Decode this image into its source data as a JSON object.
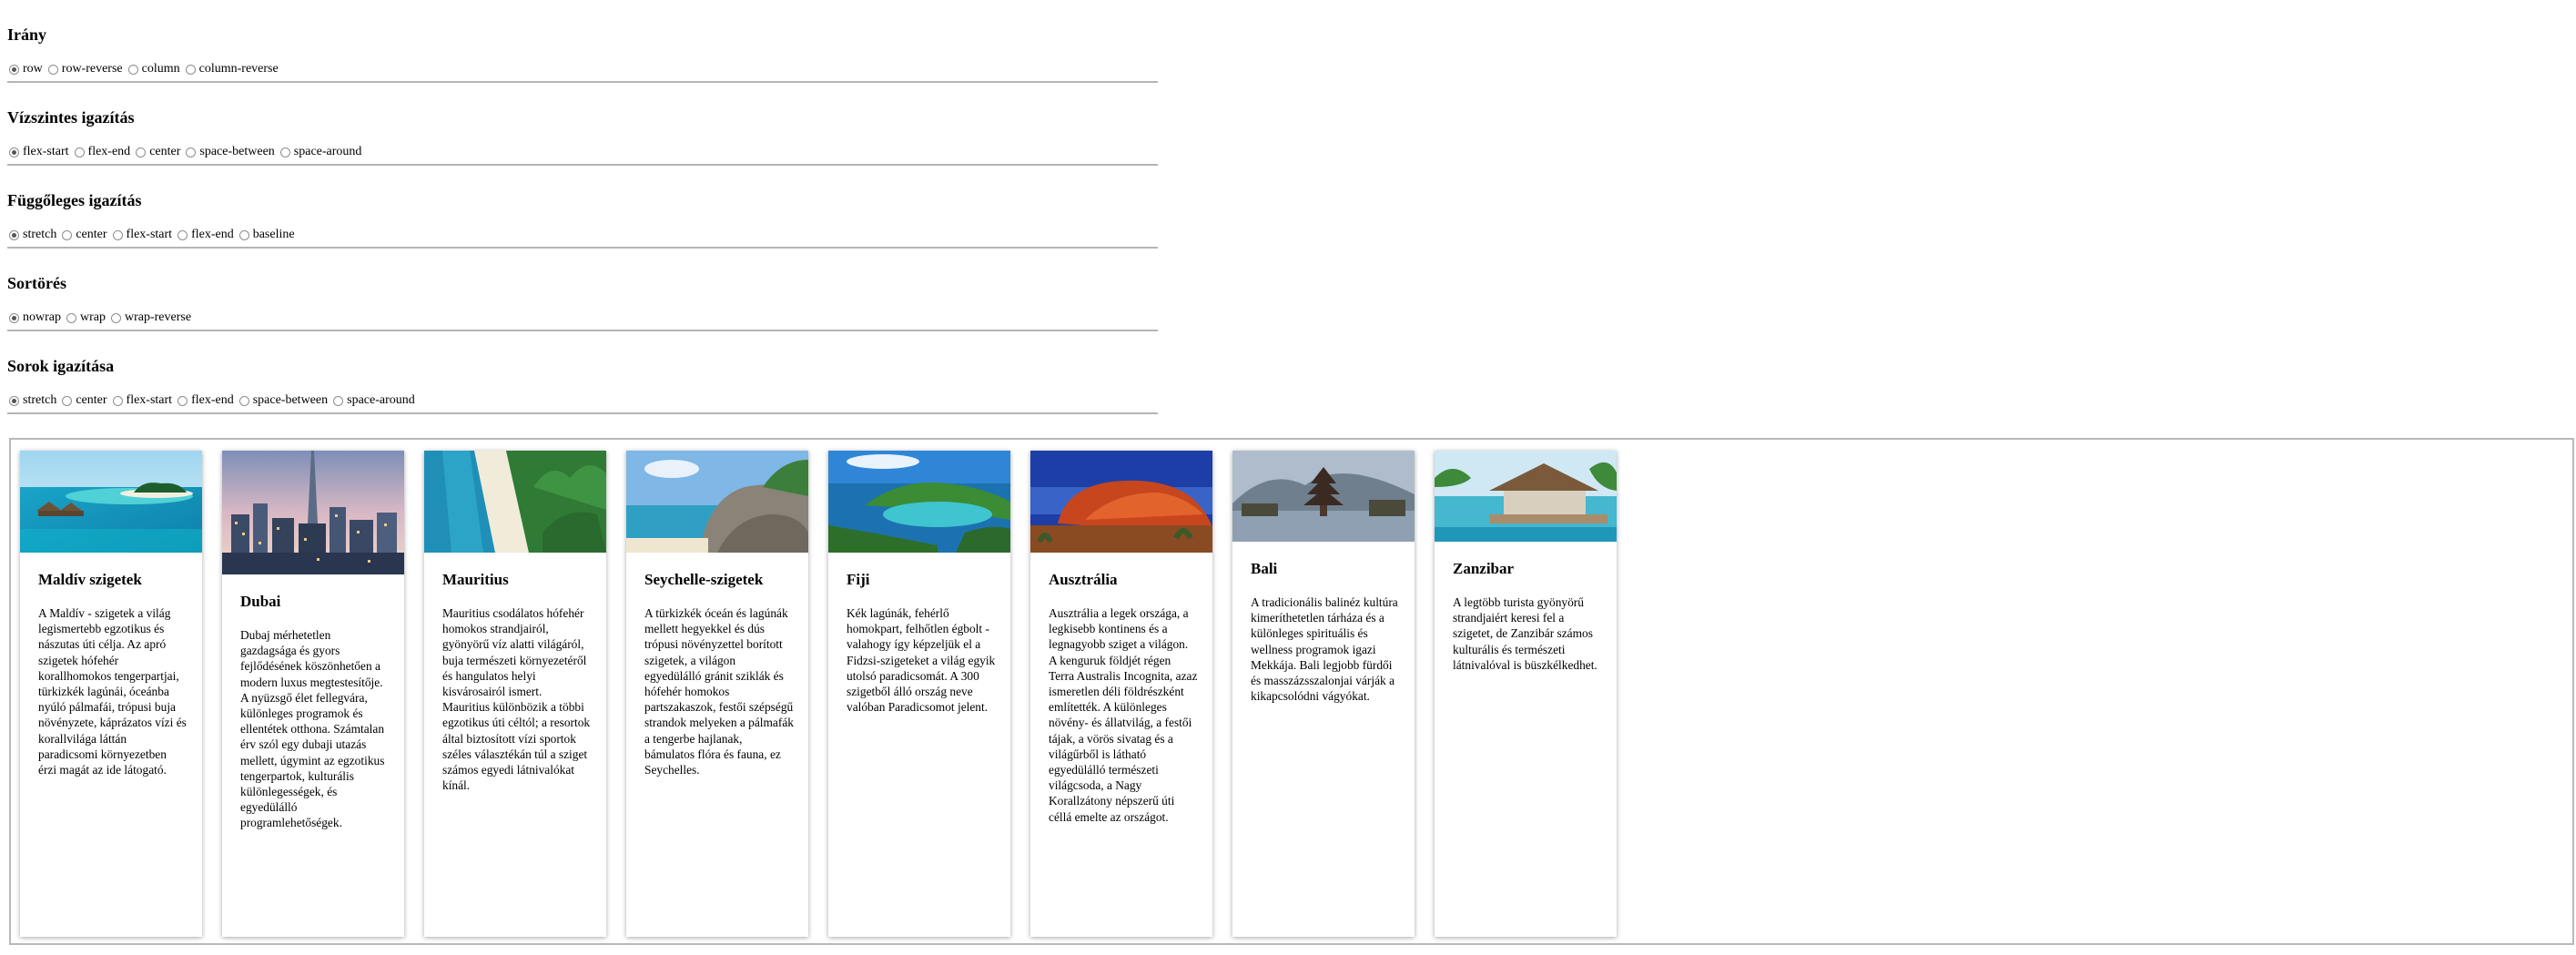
{
  "controls": {
    "direction": {
      "title": "Irány",
      "options": [
        "row",
        "row-reverse",
        "column",
        "column-reverse"
      ],
      "selected": "row"
    },
    "justify": {
      "title": "Vízszintes igazítás",
      "options": [
        "flex-start",
        "flex-end",
        "center",
        "space-between",
        "space-around"
      ],
      "selected": "flex-start"
    },
    "align_items": {
      "title": "Függőleges igazítás",
      "options": [
        "stretch",
        "center",
        "flex-start",
        "flex-end",
        "baseline"
      ],
      "selected": "stretch"
    },
    "wrap": {
      "title": "Sortörés",
      "options": [
        "nowrap",
        "wrap",
        "wrap-reverse"
      ],
      "selected": "nowrap"
    },
    "align_content": {
      "title": "Sorok igazítása",
      "options": [
        "stretch",
        "center",
        "flex-start",
        "flex-end",
        "space-between",
        "space-around"
      ],
      "selected": "stretch"
    }
  },
  "cards": [
    {
      "title": "Maldív szigetek",
      "text": "A Maldív - szigetek a világ legismertebb egzotikus és nászutas úti célja. Az apró szigetek hófehér korallhomokos tengerpartjai, türkizkék lagúnái, óceánba nyúló pálmafái, trópusi buja növényzete, káprázatos vízi és korallvilága láttán paradicsomi környezetben érzi magát az ide látogató."
    },
    {
      "title": "Dubai",
      "text": "Dubaj mérhetetlen gazdagsága és gyors fejlődésének köszönhetően a modern luxus megtestesítője. A nyüzsgő élet fellegvára, különleges programok és ellentétek otthona. Számtalan érv szól egy dubaji utazás mellett, úgymint az egzotikus tengerpartok, kulturális különlegességek, és egyedülálló programlehetőségek."
    },
    {
      "title": "Mauritius",
      "text": "Mauritius csodálatos hófehér homokos strandjairól, gyönyörű víz alatti világáról, buja természeti környezetéről és hangulatos helyi kisvárosairól ismert. Mauritius különbözik a többi egzotikus úti céltól; a resortok által biztosított vízi sportok széles választékán túl a sziget számos egyedi látnivalókat kínál."
    },
    {
      "title": "Seychelle-szigetek",
      "text": "A türkizkék óceán és lagúnák mellett hegyekkel és dús trópusi növényzettel borított szigetek, a világon egyedülálló gránit sziklák és hófehér homokos partszakaszok, festői szépségű strandok melyeken a pálmafák a tengerbe hajlanak, bámulatos flóra és fauna, ez Seychelles."
    },
    {
      "title": "Fiji",
      "text": "Kék lagúnák, fehérlő homokpart, felhőtlen égbolt - valahogy így képzeljük el a Fidzsi-szigeteket a világ egyik utolsó paradicsomát. A 300 szigetből álló ország neve valóban Paradicsomot jelent."
    },
    {
      "title": "Ausztrália",
      "text": "Ausztrália a legek országa, a legkisebb kontinens és a legnagyobb sziget a világon. A kenguruk földjét régen Terra Australis Incognita, azaz ismeretlen déli földrészként említették. A különleges növény- és állatvilág, a festői tájak, a vörös sivatag és a világűrből is látható egyedülálló természeti világcsoda, a Nagy Korallzátony népszerű úti céllá emelte az országot."
    },
    {
      "title": "Bali",
      "text": "A tradicionális balinéz kultúra kimeríthetetlen tárháza és a különleges spirituális és wellness programok igazi Mekkája. Bali legjobb fürdői és masszázsszalonjai várják a kikapcsolódni vágyókat."
    },
    {
      "title": "Zanzibar",
      "text": "A legtöbb turista gyönyörű strandjaiért keresi fel a szigetet, de Zanzibár számos kulturális és természeti látnivalóval is büszkélkedhet."
    }
  ]
}
